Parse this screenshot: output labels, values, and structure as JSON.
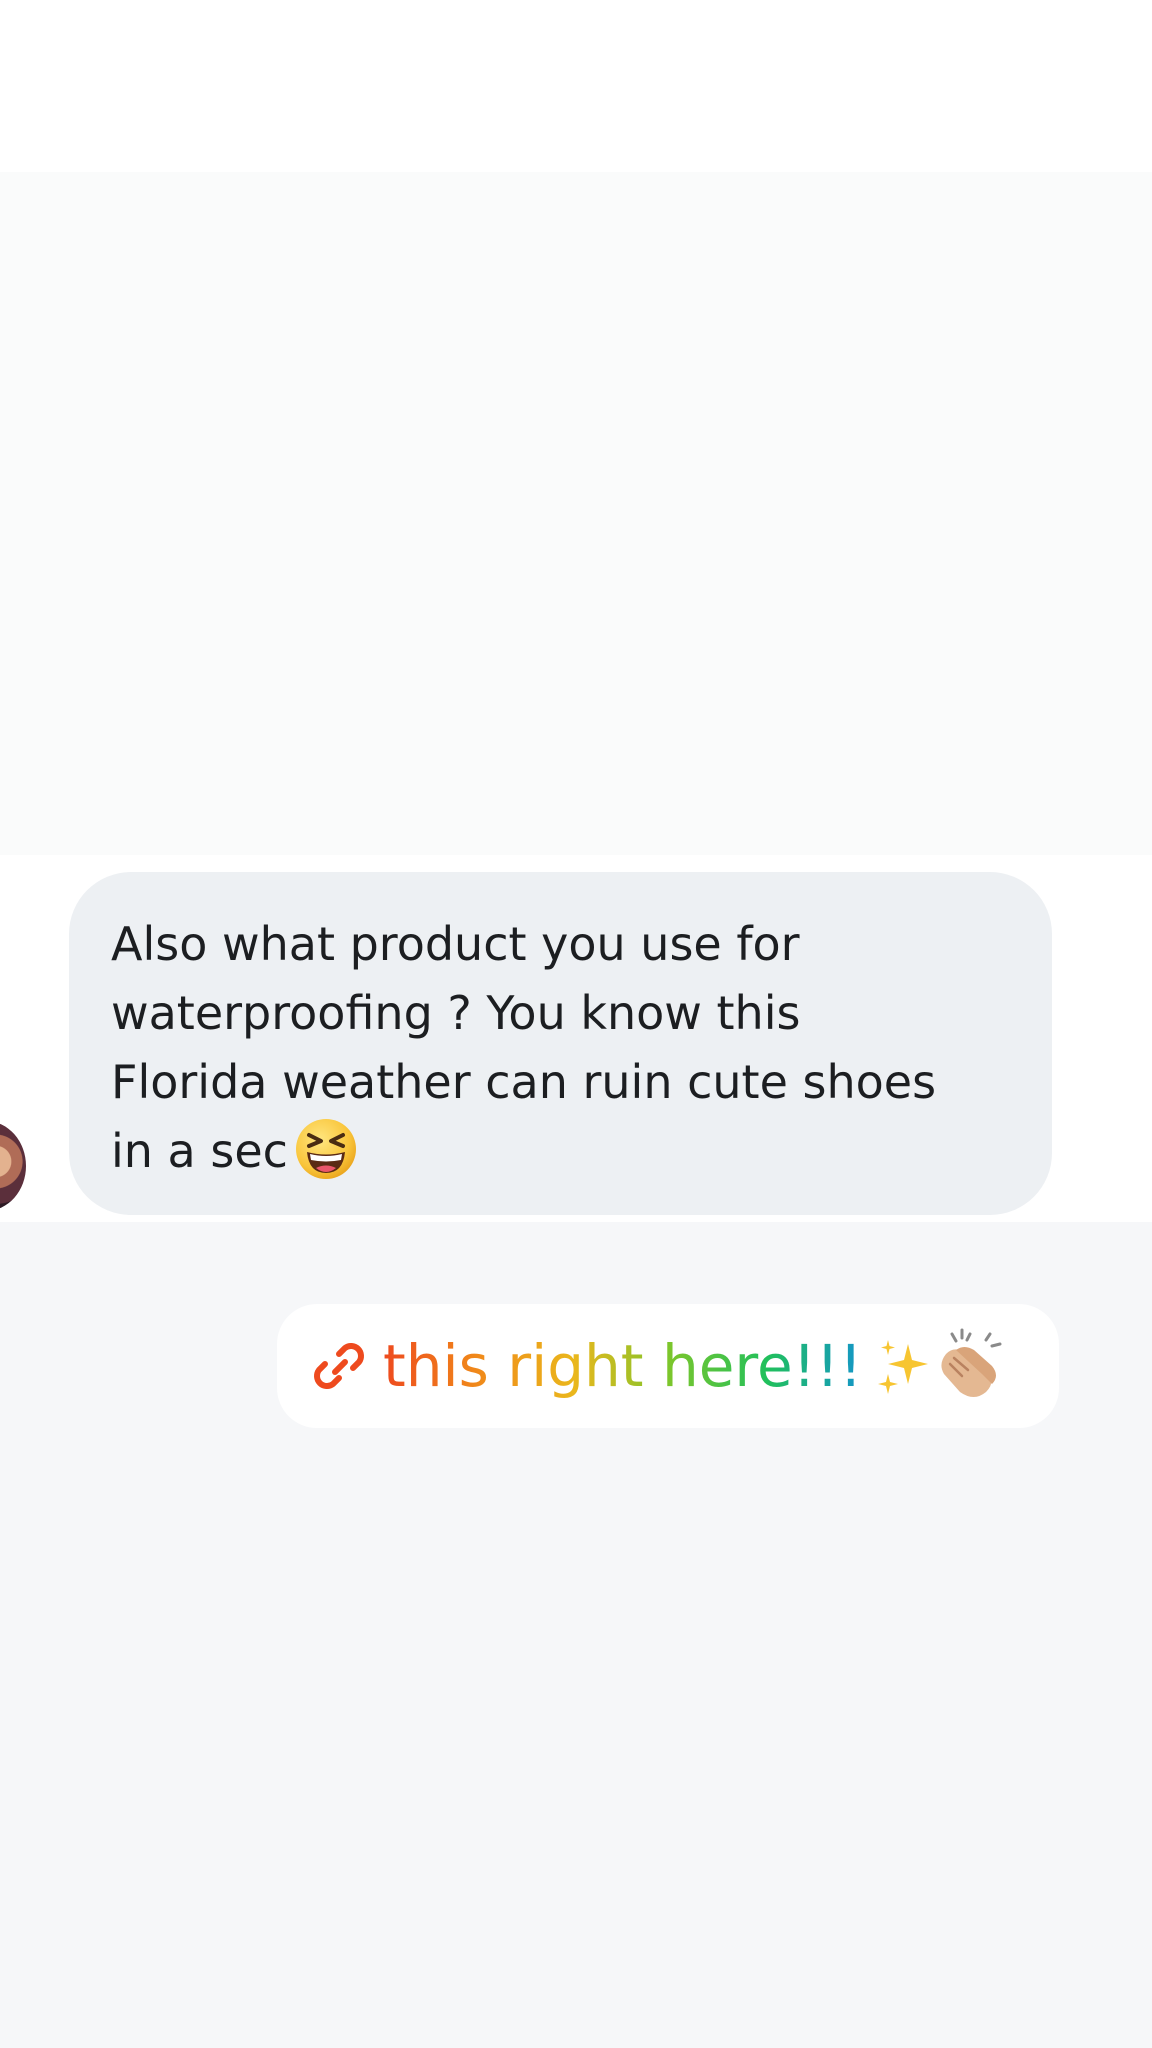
{
  "conversation": {
    "incoming_message": {
      "lines": [
        "Also what product you use for",
        "waterproofing ? You know this",
        "Florida weather can ruin cute shoes",
        "in a sec"
      ],
      "emoji": "grinning-squinting-face-icon"
    },
    "outgoing_message": {
      "text": "this right here!!!",
      "leading_icon": "link-icon",
      "trailing_icons": [
        "sparkles-icon",
        "clapping-hands-icon"
      ],
      "gradient_colors": [
        "#ee4a1e",
        "#f08a1a",
        "#eab71c",
        "#7bc62c",
        "#21c05b",
        "#1496c8"
      ]
    }
  },
  "colors": {
    "incoming_bubble": "#edf0f3",
    "incoming_text": "#1c1e21",
    "outgoing_bubble": "#ffffff"
  }
}
